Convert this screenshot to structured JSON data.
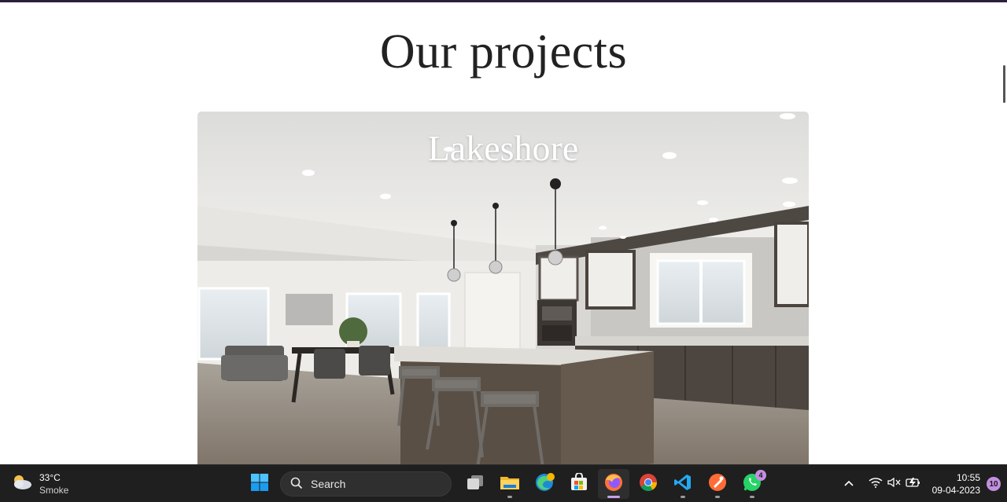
{
  "page": {
    "title": "Our projects"
  },
  "project_card": {
    "title": "Lakeshore"
  },
  "taskbar": {
    "weather": {
      "temp": "33°C",
      "condition": "Smoke"
    },
    "search": {
      "label": "Search"
    },
    "apps": [
      {
        "name": "start",
        "icon": "windows-logo"
      },
      {
        "name": "task-view",
        "icon": "task-view-icon"
      },
      {
        "name": "file-explorer",
        "icon": "folder-icon"
      },
      {
        "name": "edge",
        "icon": "edge-icon"
      },
      {
        "name": "microsoft-store",
        "icon": "store-icon"
      },
      {
        "name": "firefox",
        "icon": "firefox-icon"
      },
      {
        "name": "chrome",
        "icon": "chrome-icon"
      },
      {
        "name": "vscode",
        "icon": "vscode-icon"
      },
      {
        "name": "postman",
        "icon": "postman-icon"
      },
      {
        "name": "whatsapp",
        "icon": "whatsapp-icon"
      }
    ],
    "whatsapp_badge": "4",
    "clock": {
      "time": "10:55",
      "date": "09-04-2023"
    },
    "notifications": "10"
  },
  "colors": {
    "accent": "#c38fe0",
    "taskbar_bg": "#1f1f1f",
    "top_strip": "#2a1f3d"
  }
}
